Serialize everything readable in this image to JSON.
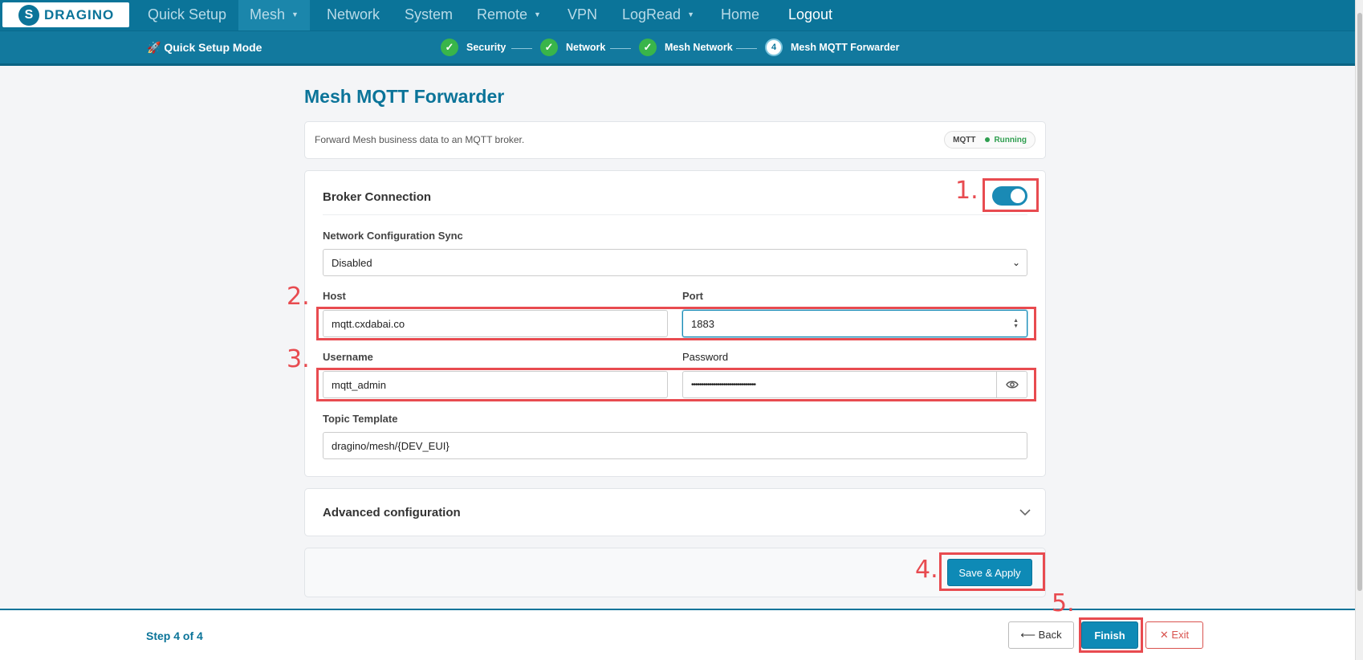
{
  "brand": {
    "name": "DRAGINO",
    "mark": "S"
  },
  "nav": {
    "items": [
      {
        "label": "Quick Setup",
        "caret": false
      },
      {
        "label": "Mesh",
        "caret": true
      },
      {
        "label": "Network",
        "caret": false
      },
      {
        "label": "System",
        "caret": false
      },
      {
        "label": "Remote",
        "caret": true
      },
      {
        "label": "VPN",
        "caret": false
      },
      {
        "label": "LogRead",
        "caret": true
      },
      {
        "label": "Home",
        "caret": false
      },
      {
        "label": "Logout",
        "caret": false
      }
    ],
    "active": "Mesh",
    "caret_glyph": "▼"
  },
  "wizard": {
    "mode_label": "Quick Setup Mode",
    "steps": [
      {
        "label": "Security",
        "status": "done",
        "marker": "✓"
      },
      {
        "label": "Network",
        "status": "done",
        "marker": "✓"
      },
      {
        "label": "Mesh Network",
        "status": "done",
        "marker": "✓"
      },
      {
        "label": "Mesh MQTT Forwarder",
        "status": "current",
        "marker": "4"
      }
    ]
  },
  "page": {
    "title": "Mesh MQTT Forwarder",
    "description": "Forward Mesh business data to an MQTT broker.",
    "badge": {
      "service": "MQTT",
      "status": "Running",
      "status_color": "#2e9e4f"
    }
  },
  "broker": {
    "title": "Broker Connection",
    "enabled": true,
    "sync_label": "Network Configuration Sync",
    "sync_value": "Disabled",
    "host_label": "Host",
    "host_value": "mqtt.cxdabai.co",
    "port_label": "Port",
    "port_value": "1883",
    "username_label": "Username",
    "username_value": "mqtt_admin",
    "password_label": "Password",
    "password_value": "••••••••••••••••••••••••••••••••",
    "topic_label": "Topic Template",
    "topic_value": "dragino/mesh/{DEV_EUI}"
  },
  "advanced": {
    "title": "Advanced configuration"
  },
  "actions": {
    "save_apply": "Save & Apply"
  },
  "footer": {
    "step_text": "Step 4 of 4",
    "back": "⟵ Back",
    "finish": "Finish",
    "exit": "✕ Exit"
  },
  "annotations": [
    "1.",
    "2.",
    "3.",
    "4.",
    "5."
  ],
  "colors": {
    "accent": "#0b7499",
    "annotation": "#e84b50",
    "success": "#39b54a"
  }
}
